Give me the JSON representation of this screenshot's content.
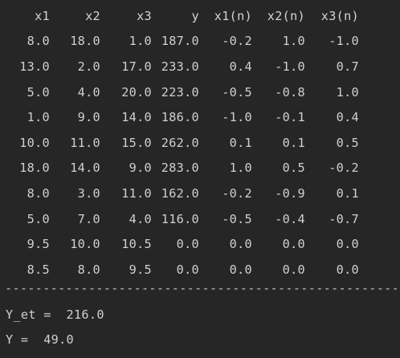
{
  "table": {
    "headers": [
      "x1",
      "x2",
      "x3",
      "y",
      "x1(n)",
      "x2(n)",
      "x3(n)"
    ],
    "rows": [
      [
        "8.0",
        "18.0",
        "1.0",
        "187.0",
        "-0.2",
        "1.0",
        "-1.0"
      ],
      [
        "13.0",
        "2.0",
        "17.0",
        "233.0",
        "0.4",
        "-1.0",
        "0.7"
      ],
      [
        "5.0",
        "4.0",
        "20.0",
        "223.0",
        "-0.5",
        "-0.8",
        "1.0"
      ],
      [
        "1.0",
        "9.0",
        "14.0",
        "186.0",
        "-1.0",
        "-0.1",
        "0.4"
      ],
      [
        "10.0",
        "11.0",
        "15.0",
        "262.0",
        "0.1",
        "0.1",
        "0.5"
      ],
      [
        "18.0",
        "14.0",
        "9.0",
        "283.0",
        "1.0",
        "0.5",
        "-0.2"
      ],
      [
        "8.0",
        "3.0",
        "11.0",
        "162.0",
        "-0.2",
        "-0.9",
        "0.1"
      ],
      [
        "5.0",
        "7.0",
        "4.0",
        "116.0",
        "-0.5",
        "-0.4",
        "-0.7"
      ],
      [
        "9.5",
        "10.0",
        "10.5",
        "0.0",
        "0.0",
        "0.0",
        "0.0"
      ],
      [
        "8.5",
        "8.0",
        "9.5",
        "0.0",
        "0.0",
        "0.0",
        "0.0"
      ]
    ]
  },
  "separator": "----------------------------------------------------------------------",
  "results": {
    "y_et": "Y_et =  216.0",
    "y": "Y =  49.0"
  },
  "colors": {
    "background": "#262626",
    "text": "#d0d0d0"
  }
}
